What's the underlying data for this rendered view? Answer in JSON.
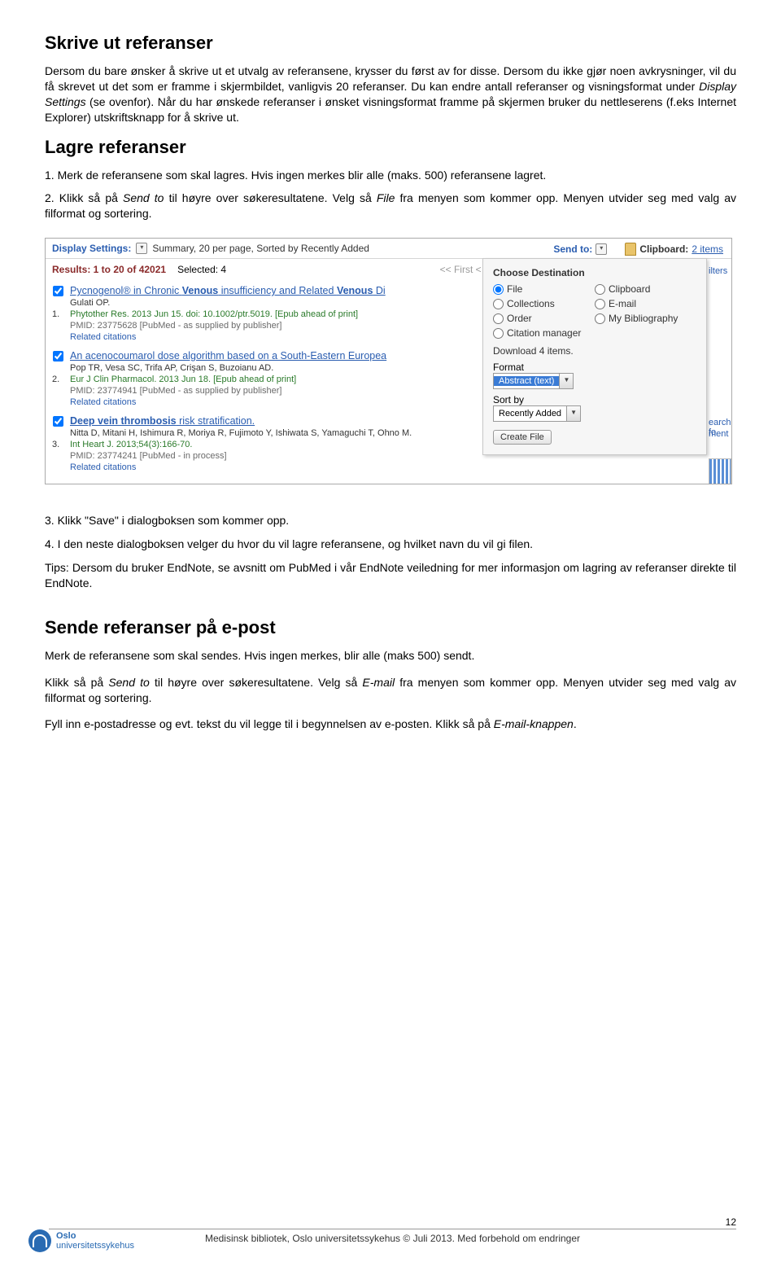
{
  "sections": {
    "skrive_ut": {
      "title": "Skrive ut referanser",
      "p1a": "Dersom du bare ønsker å skrive ut et utvalg av referansene, krysser du først av for disse. Dersom du ikke gjør noen avkrysninger, vil du få skrevet ut det som er framme i skjermbildet, vanligvis 20 referanser. Du kan endre antall referanser og visningsformat under ",
      "p1i": "Display Settings",
      "p1b": " (se ovenfor). Når du har ønskede referanser i ønsket visningsformat framme på skjermen bruker du nettleserens (f.eks Internet Explorer) utskriftsknapp for å skrive ut."
    },
    "lagre": {
      "title": "Lagre referanser",
      "n1": "1. Merk de referansene som skal lagres. Hvis ingen merkes blir alle (maks. 500) referansene lagret.",
      "n2a": "2. Klikk så på ",
      "n2i1": "Send to",
      "n2b": " til høyre over søkeresultatene. Velg så ",
      "n2i2": "File",
      "n2c": " fra menyen som kommer opp. Menyen utvider seg med valg av filformat og sortering.",
      "n3": "3. Klikk \"Save\" i dialogboksen som kommer opp.",
      "n4": "4. I den neste dialogboksen velger du hvor du vil lagre referansene, og hvilket navn du vil gi filen.",
      "tips": "Tips: Dersom du bruker EndNote, se avsnitt om PubMed i vår EndNote veiledning for mer informasjon om lagring av referanser direkte til EndNote."
    },
    "sende": {
      "title": "Sende referanser på e-post",
      "p1": "Merk de referansene som skal sendes. Hvis ingen merkes, blir alle (maks 500) sendt.",
      "p2a": "Klikk så på ",
      "p2i1": "Send to",
      "p2b": " til høyre over søkeresultatene. Velg så ",
      "p2i2": "E-mail",
      "p2c": " fra menyen som kommer opp. Menyen utvider seg med valg av filformat og sortering.",
      "p3a": "Fyll inn e-postadresse og evt. tekst du vil legge til i begynnelsen av e-posten. Klikk så på ",
      "p3i": "E-mail-knappen",
      "p3b": "."
    }
  },
  "screenshot": {
    "display_label": "Display Settings:",
    "display_value": "Summary, 20 per page, Sorted by Recently Added",
    "sendto_label": "Send to:",
    "clipboard_label": "Clipboard:",
    "clipboard_count": "2 items",
    "filters": "ilters",
    "results_label": "Results: 1 to 20 of 42021",
    "selected": "Selected: 4",
    "prev": "<< First   < Prev   P",
    "items": [
      {
        "num": "1.",
        "title_a": "Pycnogenol® in Chronic ",
        "title_b1": "Venous",
        "title_m": " insufficiency and Related ",
        "title_b2": "Venous",
        "title_e": " Di",
        "author": "Gulati OP.",
        "src": "Phytother Res. 2013 Jun 15. doi: 10.1002/ptr.5019. [Epub ahead of print]",
        "pmid": "PMID: 23775628 [PubMed - as supplied by publisher]",
        "rel": "Related citations"
      },
      {
        "num": "2.",
        "title_a": "An acenocoumarol dose algorithm based on a South-Eastern Europea",
        "title_b1": "",
        "title_m": "",
        "title_b2": "",
        "title_e": "",
        "author": "Pop TR, Vesa SC, Trifa AP, Crişan S, Buzoianu AD.",
        "src": "Eur J Clin Pharmacol. 2013 Jun 18. [Epub ahead of print]",
        "pmid": "PMID: 23774941 [PubMed - as supplied by publisher]",
        "rel": "Related citations"
      },
      {
        "num": "3.",
        "title_a": "",
        "title_b1": "Deep vein thrombosis",
        "title_m": " risk stratification.",
        "title_b2": "",
        "title_e": "",
        "author": "Nitta D, Mitani H, Ishimura R, Moriya R, Fujimoto Y, Ishiwata S, Yamaguchi T, Ohno M.",
        "src": "Int Heart J. 2013;54(3):166-70.",
        "pmid": "PMID: 23774241 [PubMed - in process]",
        "rel": "Related citations"
      }
    ],
    "panel": {
      "heading": "Choose Destination",
      "opts": {
        "file": "File",
        "clipboard": "Clipboard",
        "collections": "Collections",
        "email": "E-mail",
        "order": "Order",
        "biblio": "My Bibliography",
        "citmgr": "Citation manager"
      },
      "dlmsg": "Download 4 items.",
      "format_label": "Format",
      "format_value": "Abstract (text)",
      "sort_label": "Sort by",
      "sort_value": "Recently Added",
      "create": "Create File"
    },
    "right_hint1": "earch fo",
    "right_hint2": "ment"
  },
  "footer": {
    "text": "Medisinsk bibliotek, Oslo universitetssykehus © Juli 2013. Med forbehold om endringer",
    "pagenum": "12",
    "logo_line1": "Oslo",
    "logo_line2": "universitetssykehus"
  }
}
